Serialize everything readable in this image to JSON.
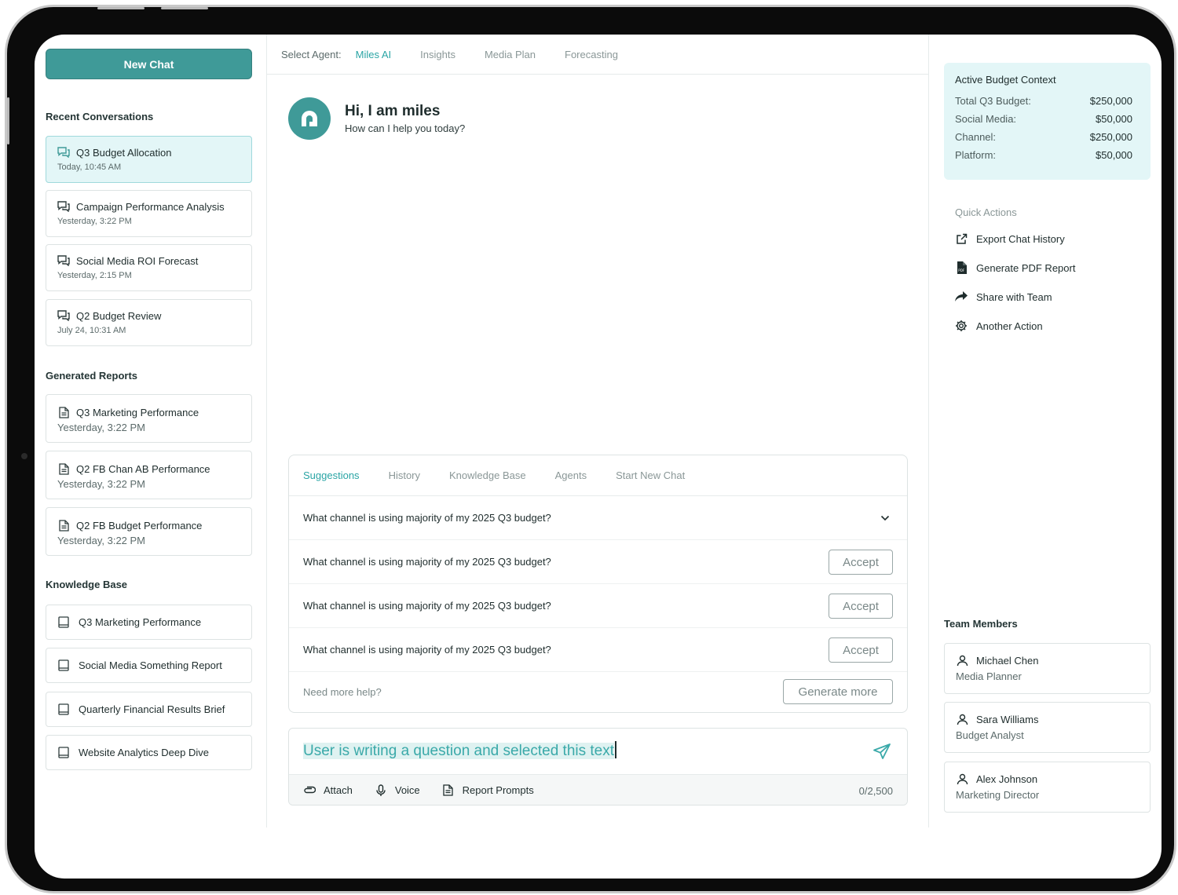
{
  "sidebar": {
    "new_chat": "New Chat",
    "recent_title": "Recent Conversations",
    "recent": [
      {
        "title": "Q3 Budget Allocation",
        "time": "Today, 10:45 AM"
      },
      {
        "title": "Campaign Performance Analysis",
        "time": "Yesterday, 3:22 PM"
      },
      {
        "title": "Social Media ROI Forecast",
        "time": "Yesterday, 2:15 PM"
      },
      {
        "title": "Q2 Budget Review",
        "time": "July 24, 10:31 AM"
      }
    ],
    "reports_title": "Generated Reports",
    "reports": [
      {
        "title": "Q3 Marketing Performance",
        "time": "Yesterday, 3:22 PM"
      },
      {
        "title": "Q2 FB Chan AB Performance",
        "time": "Yesterday, 3:22 PM"
      },
      {
        "title": "Q2 FB Budget Performance",
        "time": "Yesterday, 3:22 PM"
      }
    ],
    "kb_title": "Knowledge Base",
    "kb": [
      "Q3 Marketing Performance",
      "Social Media Something Report",
      "Quarterly Financial Results Brief",
      "Website Analytics Deep Dive"
    ]
  },
  "agent_bar": {
    "label": "Select Agent:",
    "options": [
      "Miles AI",
      "Insights",
      "Media Plan",
      "Forecasting"
    ],
    "selected": "Miles AI"
  },
  "greeting": {
    "title": "Hi, I am miles",
    "subtitle": "How can I help you today?"
  },
  "suggestions": {
    "tabs": [
      "Suggestions",
      "History",
      "Knowledge Base",
      "Agents",
      "Start New Chat"
    ],
    "selected_tab": "Suggestions",
    "questions": [
      "What channel is using majority of my 2025 Q3 budget?",
      "What channel is using majority of my 2025 Q3 budget?",
      "What channel is using majority of my 2025 Q3 budget?",
      "What channel is using majority of my 2025 Q3 budget?"
    ],
    "accept_label": "Accept",
    "help_text": "Need more help?",
    "generate_more": "Generate more"
  },
  "composer": {
    "text": "User is writing a question and selected this text",
    "attach": "Attach",
    "voice": "Voice",
    "report_prompts": "Report Prompts",
    "counter": "0/2,500"
  },
  "budget_context": {
    "title": "Active Budget Context",
    "rows": [
      {
        "label": "Total Q3 Budget:",
        "value": "$250,000"
      },
      {
        "label": "Social Media:",
        "value": "$50,000"
      },
      {
        "label": "Channel:",
        "value": "$250,000"
      },
      {
        "label": "Platform:",
        "value": "$50,000"
      }
    ]
  },
  "quick_actions": {
    "title": "Quick Actions",
    "items": [
      {
        "label": "Export Chat History",
        "icon": "external-link-icon"
      },
      {
        "label": "Generate PDF Report",
        "icon": "pdf-file-icon"
      },
      {
        "label": "Share with Team",
        "icon": "share-arrow-icon"
      },
      {
        "label": "Another Action",
        "icon": "gear-icon"
      }
    ]
  },
  "team": {
    "title": "Team Members",
    "members": [
      {
        "name": "Michael Chen",
        "role": "Media Planner"
      },
      {
        "name": "Sara Williams",
        "role": "Budget Analyst"
      },
      {
        "name": "Alex Johnson",
        "role": "Marketing Director"
      }
    ]
  },
  "colors": {
    "accent": "#3f9a98",
    "accent_text": "#2aa5a5",
    "active_bg": "#e3f6f7"
  }
}
